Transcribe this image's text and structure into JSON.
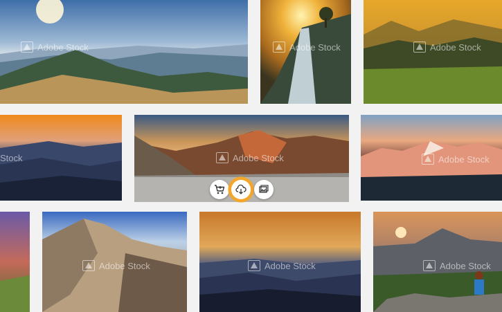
{
  "watermark": {
    "text": "Adobe Stock"
  },
  "watermark_partial": {
    "text": "Stock"
  },
  "tiles": [
    {
      "name": "mountain-valley-sunrise"
    },
    {
      "name": "waterfall-tree-sunset"
    },
    {
      "name": "green-meadow-mountains"
    },
    {
      "name": "orange-sky-ridges"
    },
    {
      "name": "rocky-peaks-panorama"
    },
    {
      "name": "alpenglow-snow-peaks"
    },
    {
      "name": "purple-sky-edge"
    },
    {
      "name": "barren-mountain"
    },
    {
      "name": "golden-layered-hills"
    },
    {
      "name": "woman-on-rocks-sunset"
    }
  ],
  "actions": [
    {
      "name": "add-to-cart-button",
      "icon": "cart-icon"
    },
    {
      "name": "download-button",
      "icon": "cloud-download-icon",
      "highlighted": true
    },
    {
      "name": "find-similar-button",
      "icon": "similar-images-icon"
    }
  ],
  "colors": {
    "highlight": "#f4a62a"
  }
}
